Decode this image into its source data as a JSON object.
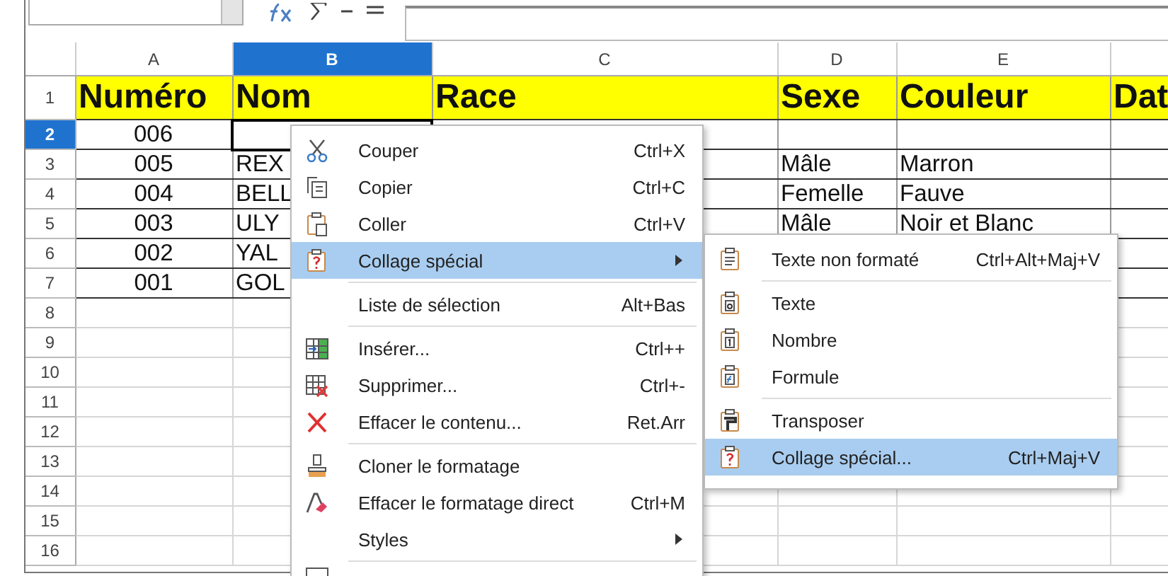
{
  "sheet": {
    "columns": [
      {
        "label": "A",
        "selected": false
      },
      {
        "label": "B",
        "selected": true
      },
      {
        "label": "C",
        "selected": false
      },
      {
        "label": "D",
        "selected": false
      },
      {
        "label": "E",
        "selected": false
      }
    ],
    "rows": [
      {
        "number": "1",
        "selected": false,
        "kind": "header",
        "cells": [
          "Numéro",
          "Nom",
          "Race",
          "Sexe",
          "Couleur",
          "Dat"
        ]
      },
      {
        "number": "2",
        "selected": true,
        "kind": "data",
        "cells": [
          "006"
        ]
      },
      {
        "number": "3",
        "selected": false,
        "kind": "data",
        "cells": [
          "005",
          "REX",
          null,
          "Mâle",
          "Marron"
        ]
      },
      {
        "number": "4",
        "selected": false,
        "kind": "data",
        "cells": [
          "004",
          "BELL",
          null,
          "Femelle",
          "Fauve"
        ]
      },
      {
        "number": "5",
        "selected": false,
        "kind": "data",
        "cells": [
          "003",
          "ULY",
          null,
          "Mâle",
          "Noir et Blanc"
        ]
      },
      {
        "number": "6",
        "selected": false,
        "kind": "data",
        "cells": [
          "002",
          "YAL"
        ]
      },
      {
        "number": "7",
        "selected": false,
        "kind": "data",
        "cells": [
          "001",
          "GOL"
        ]
      },
      {
        "number": "8",
        "selected": false,
        "kind": "empty"
      },
      {
        "number": "9",
        "selected": false,
        "kind": "empty"
      },
      {
        "number": "10",
        "selected": false,
        "kind": "empty"
      },
      {
        "number": "11",
        "selected": false,
        "kind": "empty"
      },
      {
        "number": "12",
        "selected": false,
        "kind": "empty"
      },
      {
        "number": "13",
        "selected": false,
        "kind": "empty"
      },
      {
        "number": "14",
        "selected": false,
        "kind": "empty"
      },
      {
        "number": "15",
        "selected": false,
        "kind": "empty"
      },
      {
        "number": "16",
        "selected": false,
        "kind": "empty"
      }
    ]
  },
  "context_menu": {
    "items": [
      {
        "kind": "item",
        "label": "Couper",
        "shortcut": "Ctrl+X",
        "selected": false,
        "submenu": false
      },
      {
        "kind": "item",
        "label": "Copier",
        "shortcut": "Ctrl+C",
        "selected": false,
        "submenu": false
      },
      {
        "kind": "item",
        "label": "Coller",
        "shortcut": "Ctrl+V",
        "selected": false,
        "submenu": false
      },
      {
        "kind": "item",
        "label": "Collage spécial",
        "selected": true,
        "submenu": true
      },
      {
        "kind": "separator"
      },
      {
        "kind": "item",
        "label": "Liste de sélection",
        "shortcut": "Alt+Bas",
        "selected": false,
        "submenu": false
      },
      {
        "kind": "separator"
      },
      {
        "kind": "item",
        "label": "Insérer...",
        "shortcut": "Ctrl++",
        "selected": false,
        "submenu": false
      },
      {
        "kind": "item",
        "label": "Supprimer...",
        "shortcut": "Ctrl+-",
        "selected": false,
        "submenu": false
      },
      {
        "kind": "item",
        "label": "Effacer le contenu...",
        "shortcut": "Ret.Arr",
        "selected": false,
        "submenu": false
      },
      {
        "kind": "separator"
      },
      {
        "kind": "item",
        "label": "Cloner le formatage",
        "selected": false,
        "submenu": false
      },
      {
        "kind": "item",
        "label": "Effacer le formatage direct",
        "shortcut": "Ctrl+M",
        "selected": false,
        "submenu": false
      },
      {
        "kind": "item",
        "label": "Styles",
        "selected": false,
        "submenu": true
      },
      {
        "kind": "separator"
      }
    ]
  },
  "submenu": {
    "items": [
      {
        "kind": "item",
        "label": "Texte non formaté",
        "shortcut": "Ctrl+Alt+Maj+V",
        "selected": false
      },
      {
        "kind": "separator"
      },
      {
        "kind": "item",
        "label": "Texte",
        "selected": false
      },
      {
        "kind": "item",
        "label": "Nombre",
        "selected": false
      },
      {
        "kind": "item",
        "label": "Formule",
        "selected": false
      },
      {
        "kind": "separator"
      },
      {
        "kind": "item",
        "label": "Transposer",
        "selected": false
      },
      {
        "kind": "item",
        "label": "Collage spécial...",
        "shortcut": "Ctrl+Maj+V",
        "selected": true
      }
    ]
  }
}
